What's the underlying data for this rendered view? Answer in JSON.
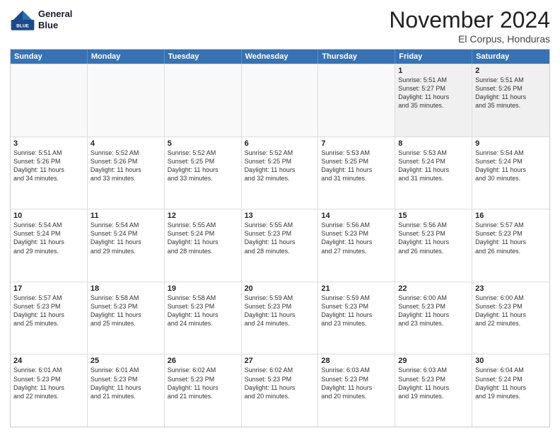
{
  "logo": {
    "line1": "General",
    "line2": "Blue"
  },
  "title": "November 2024",
  "subtitle": "El Corpus, Honduras",
  "days_of_week": [
    "Sunday",
    "Monday",
    "Tuesday",
    "Wednesday",
    "Thursday",
    "Friday",
    "Saturday"
  ],
  "weeks": [
    [
      {
        "day": "",
        "info": "",
        "empty": true
      },
      {
        "day": "",
        "info": "",
        "empty": true
      },
      {
        "day": "",
        "info": "",
        "empty": true
      },
      {
        "day": "",
        "info": "",
        "empty": true
      },
      {
        "day": "",
        "info": "",
        "empty": true
      },
      {
        "day": "1",
        "info": "Sunrise: 5:51 AM\nSunset: 5:27 PM\nDaylight: 11 hours\nand 35 minutes."
      },
      {
        "day": "2",
        "info": "Sunrise: 5:51 AM\nSunset: 5:26 PM\nDaylight: 11 hours\nand 35 minutes."
      }
    ],
    [
      {
        "day": "3",
        "info": "Sunrise: 5:51 AM\nSunset: 5:26 PM\nDaylight: 11 hours\nand 34 minutes."
      },
      {
        "day": "4",
        "info": "Sunrise: 5:52 AM\nSunset: 5:26 PM\nDaylight: 11 hours\nand 33 minutes."
      },
      {
        "day": "5",
        "info": "Sunrise: 5:52 AM\nSunset: 5:25 PM\nDaylight: 11 hours\nand 33 minutes."
      },
      {
        "day": "6",
        "info": "Sunrise: 5:52 AM\nSunset: 5:25 PM\nDaylight: 11 hours\nand 32 minutes."
      },
      {
        "day": "7",
        "info": "Sunrise: 5:53 AM\nSunset: 5:25 PM\nDaylight: 11 hours\nand 31 minutes."
      },
      {
        "day": "8",
        "info": "Sunrise: 5:53 AM\nSunset: 5:24 PM\nDaylight: 11 hours\nand 31 minutes."
      },
      {
        "day": "9",
        "info": "Sunrise: 5:54 AM\nSunset: 5:24 PM\nDaylight: 11 hours\nand 30 minutes."
      }
    ],
    [
      {
        "day": "10",
        "info": "Sunrise: 5:54 AM\nSunset: 5:24 PM\nDaylight: 11 hours\nand 29 minutes."
      },
      {
        "day": "11",
        "info": "Sunrise: 5:54 AM\nSunset: 5:24 PM\nDaylight: 11 hours\nand 29 minutes."
      },
      {
        "day": "12",
        "info": "Sunrise: 5:55 AM\nSunset: 5:24 PM\nDaylight: 11 hours\nand 28 minutes."
      },
      {
        "day": "13",
        "info": "Sunrise: 5:55 AM\nSunset: 5:23 PM\nDaylight: 11 hours\nand 28 minutes."
      },
      {
        "day": "14",
        "info": "Sunrise: 5:56 AM\nSunset: 5:23 PM\nDaylight: 11 hours\nand 27 minutes."
      },
      {
        "day": "15",
        "info": "Sunrise: 5:56 AM\nSunset: 5:23 PM\nDaylight: 11 hours\nand 26 minutes."
      },
      {
        "day": "16",
        "info": "Sunrise: 5:57 AM\nSunset: 5:23 PM\nDaylight: 11 hours\nand 26 minutes."
      }
    ],
    [
      {
        "day": "17",
        "info": "Sunrise: 5:57 AM\nSunset: 5:23 PM\nDaylight: 11 hours\nand 25 minutes."
      },
      {
        "day": "18",
        "info": "Sunrise: 5:58 AM\nSunset: 5:23 PM\nDaylight: 11 hours\nand 25 minutes."
      },
      {
        "day": "19",
        "info": "Sunrise: 5:58 AM\nSunset: 5:23 PM\nDaylight: 11 hours\nand 24 minutes."
      },
      {
        "day": "20",
        "info": "Sunrise: 5:59 AM\nSunset: 5:23 PM\nDaylight: 11 hours\nand 24 minutes."
      },
      {
        "day": "21",
        "info": "Sunrise: 5:59 AM\nSunset: 5:23 PM\nDaylight: 11 hours\nand 23 minutes."
      },
      {
        "day": "22",
        "info": "Sunrise: 6:00 AM\nSunset: 5:23 PM\nDaylight: 11 hours\nand 23 minutes."
      },
      {
        "day": "23",
        "info": "Sunrise: 6:00 AM\nSunset: 5:23 PM\nDaylight: 11 hours\nand 22 minutes."
      }
    ],
    [
      {
        "day": "24",
        "info": "Sunrise: 6:01 AM\nSunset: 5:23 PM\nDaylight: 11 hours\nand 22 minutes."
      },
      {
        "day": "25",
        "info": "Sunrise: 6:01 AM\nSunset: 5:23 PM\nDaylight: 11 hours\nand 21 minutes."
      },
      {
        "day": "26",
        "info": "Sunrise: 6:02 AM\nSunset: 5:23 PM\nDaylight: 11 hours\nand 21 minutes."
      },
      {
        "day": "27",
        "info": "Sunrise: 6:02 AM\nSunset: 5:23 PM\nDaylight: 11 hours\nand 20 minutes."
      },
      {
        "day": "28",
        "info": "Sunrise: 6:03 AM\nSunset: 5:23 PM\nDaylight: 11 hours\nand 20 minutes."
      },
      {
        "day": "29",
        "info": "Sunrise: 6:03 AM\nSunset: 5:23 PM\nDaylight: 11 hours\nand 19 minutes."
      },
      {
        "day": "30",
        "info": "Sunrise: 6:04 AM\nSunset: 5:24 PM\nDaylight: 11 hours\nand 19 minutes."
      }
    ]
  ]
}
